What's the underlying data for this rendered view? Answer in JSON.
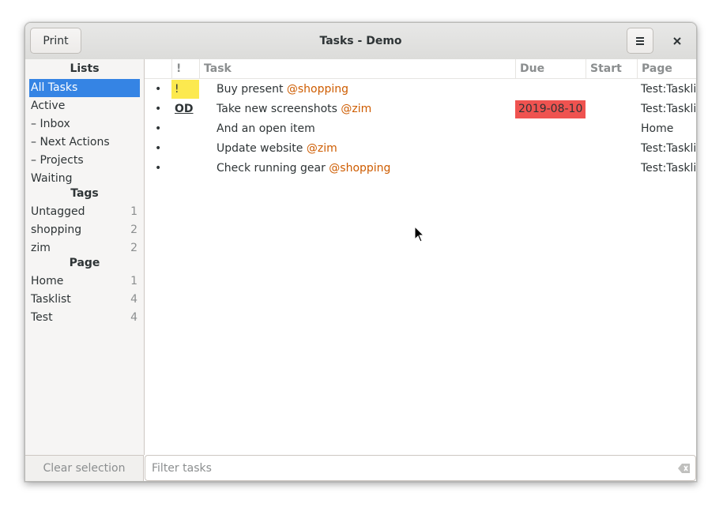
{
  "window": {
    "title": "Tasks  -  Demo"
  },
  "header": {
    "print_label": "Print",
    "menu_icon": "hamburger-menu-icon",
    "close_icon": "close-icon"
  },
  "sidebar": {
    "lists_heading": "Lists",
    "lists": [
      {
        "label": "All Tasks",
        "selected": true
      },
      {
        "label": "Active"
      },
      {
        "label": "– Inbox"
      },
      {
        "label": "– Next Actions"
      },
      {
        "label": "– Projects"
      },
      {
        "label": "Waiting"
      }
    ],
    "tags_heading": "Tags",
    "tags": [
      {
        "label": "Untagged",
        "count": "1"
      },
      {
        "label": "shopping",
        "count": "2"
      },
      {
        "label": "zim",
        "count": "2"
      }
    ],
    "page_heading": "Page",
    "pages": [
      {
        "label": "Home",
        "count": "1"
      },
      {
        "label": "Tasklist",
        "count": "4"
      },
      {
        "label": "Test",
        "count": "4"
      }
    ],
    "clear_label": "Clear selection"
  },
  "table": {
    "columns": {
      "prio": "!",
      "task": "Task",
      "due": "Due",
      "start": "Start",
      "page": "Page"
    },
    "rows": [
      {
        "bullet": "•",
        "prio": "!",
        "task": "Buy present",
        "tag": "@shopping",
        "due": "",
        "start": "",
        "page": "Test:Tasklist"
      },
      {
        "bullet": "•",
        "prio": "OD",
        "task": "Take new screenshots",
        "tag": "@zim",
        "due": "2019-08-10",
        "start": "",
        "page": "Test:Tasklist"
      },
      {
        "bullet": "•",
        "prio": "",
        "task": "And an open item",
        "tag": "",
        "due": "",
        "start": "",
        "page": "Home"
      },
      {
        "bullet": "•",
        "prio": "",
        "task": "Update website",
        "tag": "@zim",
        "due": "",
        "start": "",
        "page": "Test:Tasklist"
      },
      {
        "bullet": "•",
        "prio": "",
        "task": "Check running gear",
        "tag": "@shopping",
        "due": "",
        "start": "",
        "page": "Test:Tasklist"
      }
    ]
  },
  "filter": {
    "placeholder": "Filter tasks",
    "clear_icon": "backspace-clear-icon"
  },
  "colors": {
    "accent": "#3584e4",
    "tag": "#ce5c00",
    "priority_highlight": "#fce94f",
    "overdue": "#ef5350"
  }
}
